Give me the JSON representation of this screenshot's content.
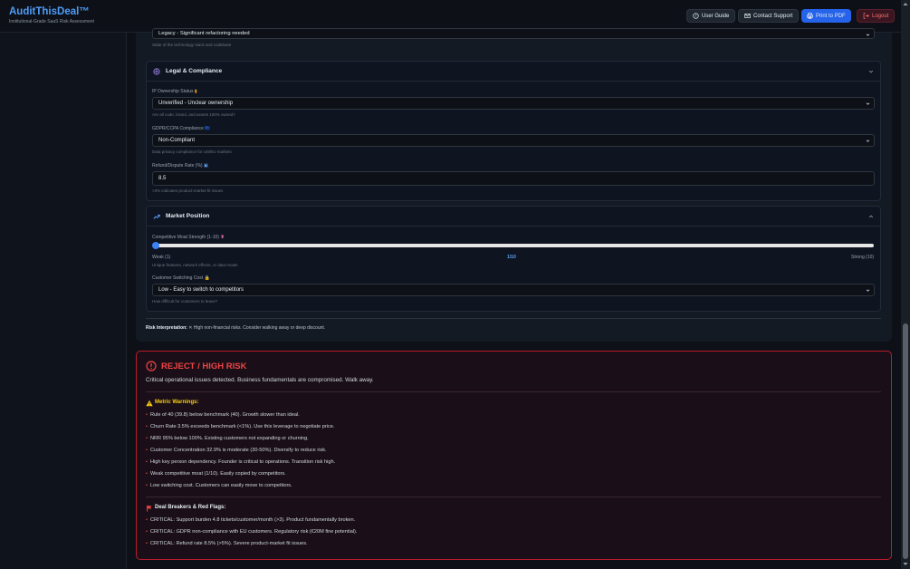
{
  "header": {
    "title": "AuditThisDeal™",
    "subtitle": "Institutional-Grade SaaS Risk Assessment",
    "buttons": {
      "user_guide": "User Guide",
      "contact": "Contact Support",
      "print": "Print to PDF",
      "logout": "Logout"
    }
  },
  "tech": {
    "selected": "Legacy - Significant refactoring needed",
    "hint": "State of the technology stack and codebase"
  },
  "legal": {
    "title": "Legal & Compliance",
    "ip_label": "IP Ownership Status",
    "ip_value": "Unverified - Unclear ownership",
    "ip_hint": "Are all code, brand, and assets 100% owned?",
    "gdpr_label": "GDPR/CCPA Compliance",
    "gdpr_value": "Non-Compliant",
    "gdpr_hint": "Data privacy compliance for US/EU markets",
    "refund_label": "Refund/Dispute Rate (%)",
    "refund_value": "8.5",
    "refund_hint": ">3% indicates product-market fit issues"
  },
  "market": {
    "title": "Market Position",
    "moat_label": "Competitive Moat Strength (1-10)",
    "moat_value": 1,
    "moat_min_label": "Weak (1)",
    "moat_current_label": "1/10",
    "moat_max_label": "Strong (10)",
    "moat_hint": "Unique features, network effects, or data moats",
    "switch_label": "Customer Switching Cost",
    "switch_value": "Low - Easy to switch to competitors",
    "switch_hint": "How difficult for customers to leave?"
  },
  "risk_interpretation": {
    "label": "Risk Interpretation:",
    "text": "✕ High non-financial risks. Consider walking away or deep discount."
  },
  "verdict": {
    "title": "REJECT / HIGH RISK",
    "description": "Critical operational issues detected. Business fundamentals are compromised. Walk away.",
    "warnings_title": "Metric Warnings:",
    "warnings": [
      "Rule of 40 (39.8) below benchmark (40). Growth slower than ideal.",
      "Churn Rate 3.5% exceeds benchmark (<1%). Use this leverage to negotiate price.",
      "NRR 95% below 100%. Existing customers not expanding or churning.",
      "Customer Concentration 32.9% is moderate (30-50%). Diversify to reduce risk.",
      "High key person dependency. Founder is critical to operations. Transition risk high.",
      "Weak competitive moat (1/10). Easily copied by competitors.",
      "Low switching cost. Customers can easily move to competitors."
    ],
    "breakers_title": "Deal Breakers & Red Flags:",
    "breakers": [
      "CRITICAL: Support burden 4.8 tickets/customer/month (>3). Product fundamentally broken.",
      "CRITICAL: GDPR non-compliance with EU customers. Regulatory risk (€20M fine potential).",
      "CRITICAL: Refund rate 8.5% (>5%). Severe product-market fit issues."
    ]
  },
  "colors": {
    "accent": "#4f9cf9",
    "danger": "#ef4444",
    "warning": "#facc15"
  }
}
